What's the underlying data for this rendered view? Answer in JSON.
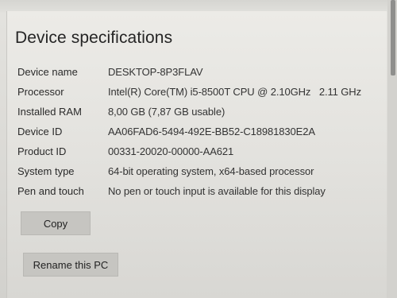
{
  "section": {
    "title": "Device specifications"
  },
  "specs": [
    {
      "label": "Device name",
      "value": "DESKTOP-8P3FLAV"
    },
    {
      "label": "Processor",
      "value": "Intel(R) Core(TM) i5-8500T CPU @ 2.10GHz   2.11 GHz"
    },
    {
      "label": "Installed RAM",
      "value": "8,00 GB (7,87 GB usable)"
    },
    {
      "label": "Device ID",
      "value": "AA06FAD6-5494-492E-BB52-C18981830E2A"
    },
    {
      "label": "Product ID",
      "value": "00331-20020-00000-AA621"
    },
    {
      "label": "System type",
      "value": "64-bit operating system, x64-based processor"
    },
    {
      "label": "Pen and touch",
      "value": "No pen or touch input is available for this display"
    }
  ],
  "buttons": {
    "copy_label": "Copy",
    "rename_label": "Rename this PC"
  }
}
